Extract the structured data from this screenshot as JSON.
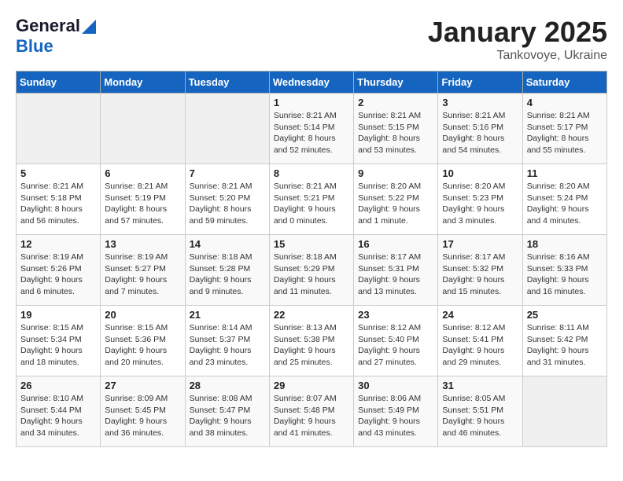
{
  "header": {
    "logo_general": "General",
    "logo_blue": "Blue",
    "title": "January 2025",
    "subtitle": "Tankovoye, Ukraine"
  },
  "weekdays": [
    "Sunday",
    "Monday",
    "Tuesday",
    "Wednesday",
    "Thursday",
    "Friday",
    "Saturday"
  ],
  "weeks": [
    [
      {
        "day": "",
        "info": ""
      },
      {
        "day": "",
        "info": ""
      },
      {
        "day": "",
        "info": ""
      },
      {
        "day": "1",
        "info": "Sunrise: 8:21 AM\nSunset: 5:14 PM\nDaylight: 8 hours and 52 minutes."
      },
      {
        "day": "2",
        "info": "Sunrise: 8:21 AM\nSunset: 5:15 PM\nDaylight: 8 hours and 53 minutes."
      },
      {
        "day": "3",
        "info": "Sunrise: 8:21 AM\nSunset: 5:16 PM\nDaylight: 8 hours and 54 minutes."
      },
      {
        "day": "4",
        "info": "Sunrise: 8:21 AM\nSunset: 5:17 PM\nDaylight: 8 hours and 55 minutes."
      }
    ],
    [
      {
        "day": "5",
        "info": "Sunrise: 8:21 AM\nSunset: 5:18 PM\nDaylight: 8 hours and 56 minutes."
      },
      {
        "day": "6",
        "info": "Sunrise: 8:21 AM\nSunset: 5:19 PM\nDaylight: 8 hours and 57 minutes."
      },
      {
        "day": "7",
        "info": "Sunrise: 8:21 AM\nSunset: 5:20 PM\nDaylight: 8 hours and 59 minutes."
      },
      {
        "day": "8",
        "info": "Sunrise: 8:21 AM\nSunset: 5:21 PM\nDaylight: 9 hours and 0 minutes."
      },
      {
        "day": "9",
        "info": "Sunrise: 8:20 AM\nSunset: 5:22 PM\nDaylight: 9 hours and 1 minute."
      },
      {
        "day": "10",
        "info": "Sunrise: 8:20 AM\nSunset: 5:23 PM\nDaylight: 9 hours and 3 minutes."
      },
      {
        "day": "11",
        "info": "Sunrise: 8:20 AM\nSunset: 5:24 PM\nDaylight: 9 hours and 4 minutes."
      }
    ],
    [
      {
        "day": "12",
        "info": "Sunrise: 8:19 AM\nSunset: 5:26 PM\nDaylight: 9 hours and 6 minutes."
      },
      {
        "day": "13",
        "info": "Sunrise: 8:19 AM\nSunset: 5:27 PM\nDaylight: 9 hours and 7 minutes."
      },
      {
        "day": "14",
        "info": "Sunrise: 8:18 AM\nSunset: 5:28 PM\nDaylight: 9 hours and 9 minutes."
      },
      {
        "day": "15",
        "info": "Sunrise: 8:18 AM\nSunset: 5:29 PM\nDaylight: 9 hours and 11 minutes."
      },
      {
        "day": "16",
        "info": "Sunrise: 8:17 AM\nSunset: 5:31 PM\nDaylight: 9 hours and 13 minutes."
      },
      {
        "day": "17",
        "info": "Sunrise: 8:17 AM\nSunset: 5:32 PM\nDaylight: 9 hours and 15 minutes."
      },
      {
        "day": "18",
        "info": "Sunrise: 8:16 AM\nSunset: 5:33 PM\nDaylight: 9 hours and 16 minutes."
      }
    ],
    [
      {
        "day": "19",
        "info": "Sunrise: 8:15 AM\nSunset: 5:34 PM\nDaylight: 9 hours and 18 minutes."
      },
      {
        "day": "20",
        "info": "Sunrise: 8:15 AM\nSunset: 5:36 PM\nDaylight: 9 hours and 20 minutes."
      },
      {
        "day": "21",
        "info": "Sunrise: 8:14 AM\nSunset: 5:37 PM\nDaylight: 9 hours and 23 minutes."
      },
      {
        "day": "22",
        "info": "Sunrise: 8:13 AM\nSunset: 5:38 PM\nDaylight: 9 hours and 25 minutes."
      },
      {
        "day": "23",
        "info": "Sunrise: 8:12 AM\nSunset: 5:40 PM\nDaylight: 9 hours and 27 minutes."
      },
      {
        "day": "24",
        "info": "Sunrise: 8:12 AM\nSunset: 5:41 PM\nDaylight: 9 hours and 29 minutes."
      },
      {
        "day": "25",
        "info": "Sunrise: 8:11 AM\nSunset: 5:42 PM\nDaylight: 9 hours and 31 minutes."
      }
    ],
    [
      {
        "day": "26",
        "info": "Sunrise: 8:10 AM\nSunset: 5:44 PM\nDaylight: 9 hours and 34 minutes."
      },
      {
        "day": "27",
        "info": "Sunrise: 8:09 AM\nSunset: 5:45 PM\nDaylight: 9 hours and 36 minutes."
      },
      {
        "day": "28",
        "info": "Sunrise: 8:08 AM\nSunset: 5:47 PM\nDaylight: 9 hours and 38 minutes."
      },
      {
        "day": "29",
        "info": "Sunrise: 8:07 AM\nSunset: 5:48 PM\nDaylight: 9 hours and 41 minutes."
      },
      {
        "day": "30",
        "info": "Sunrise: 8:06 AM\nSunset: 5:49 PM\nDaylight: 9 hours and 43 minutes."
      },
      {
        "day": "31",
        "info": "Sunrise: 8:05 AM\nSunset: 5:51 PM\nDaylight: 9 hours and 46 minutes."
      },
      {
        "day": "",
        "info": ""
      }
    ]
  ]
}
